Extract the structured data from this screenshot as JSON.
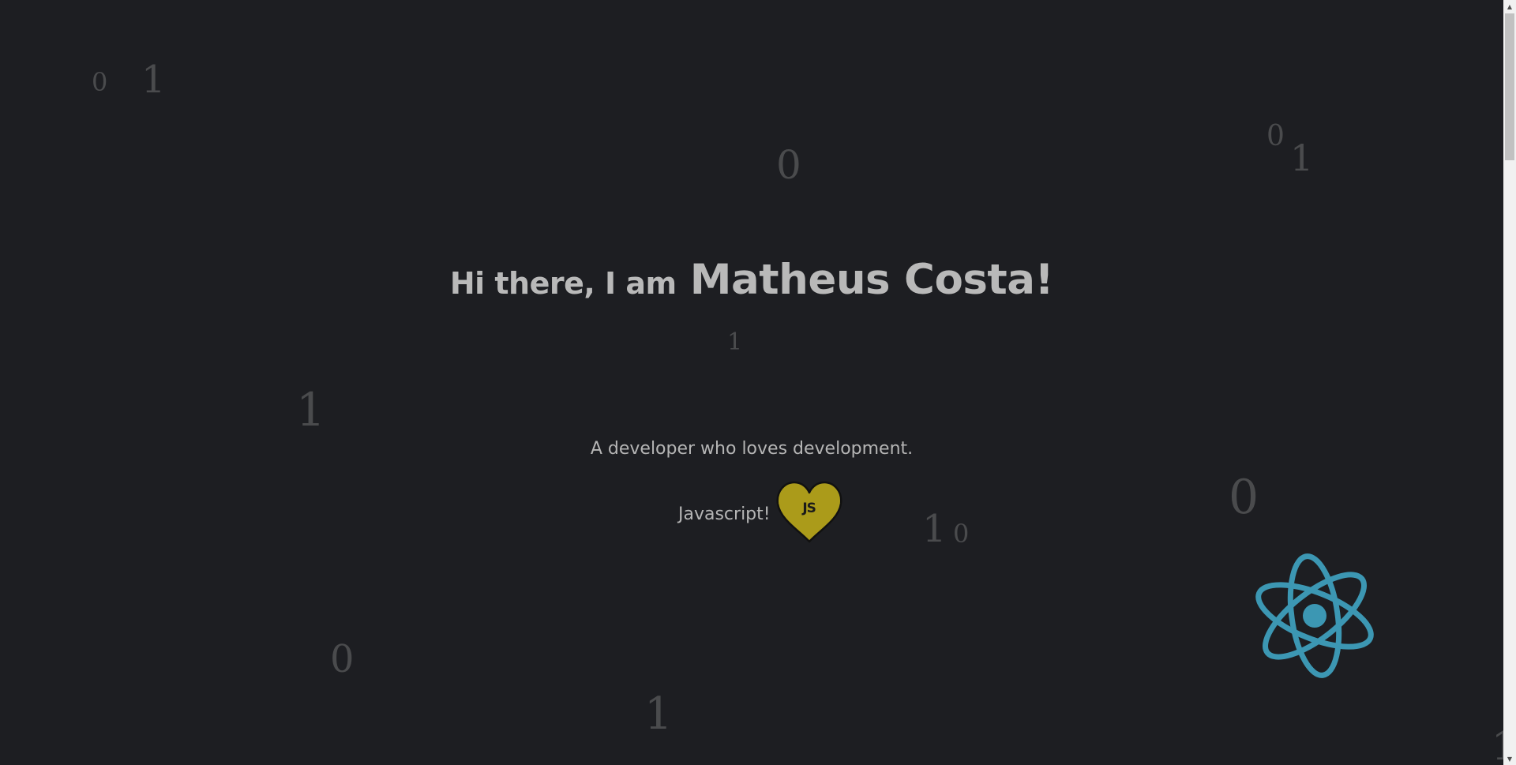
{
  "hero": {
    "greeting": "Hi there, I am",
    "name": "Matheus Costa!",
    "tagline": "A developer who loves development.",
    "favorite_label": "Javascript!",
    "heart_badge": "JS"
  },
  "background_digits": [
    "0",
    "1",
    "0",
    "0",
    "1",
    "1",
    "1",
    "0",
    "1",
    "0",
    "0",
    "1",
    "1"
  ],
  "icons": {
    "heart": "heart-icon",
    "react": "react-atom-icon"
  },
  "colors": {
    "background": "#1d1e22",
    "text": "#b9b9b9",
    "digits": "#4a4b4d",
    "heart_fill": "#ab9b1a",
    "react": "#3c97b3"
  },
  "scrollbar": {
    "up_arrow": "▲",
    "down_arrow": "▼"
  }
}
